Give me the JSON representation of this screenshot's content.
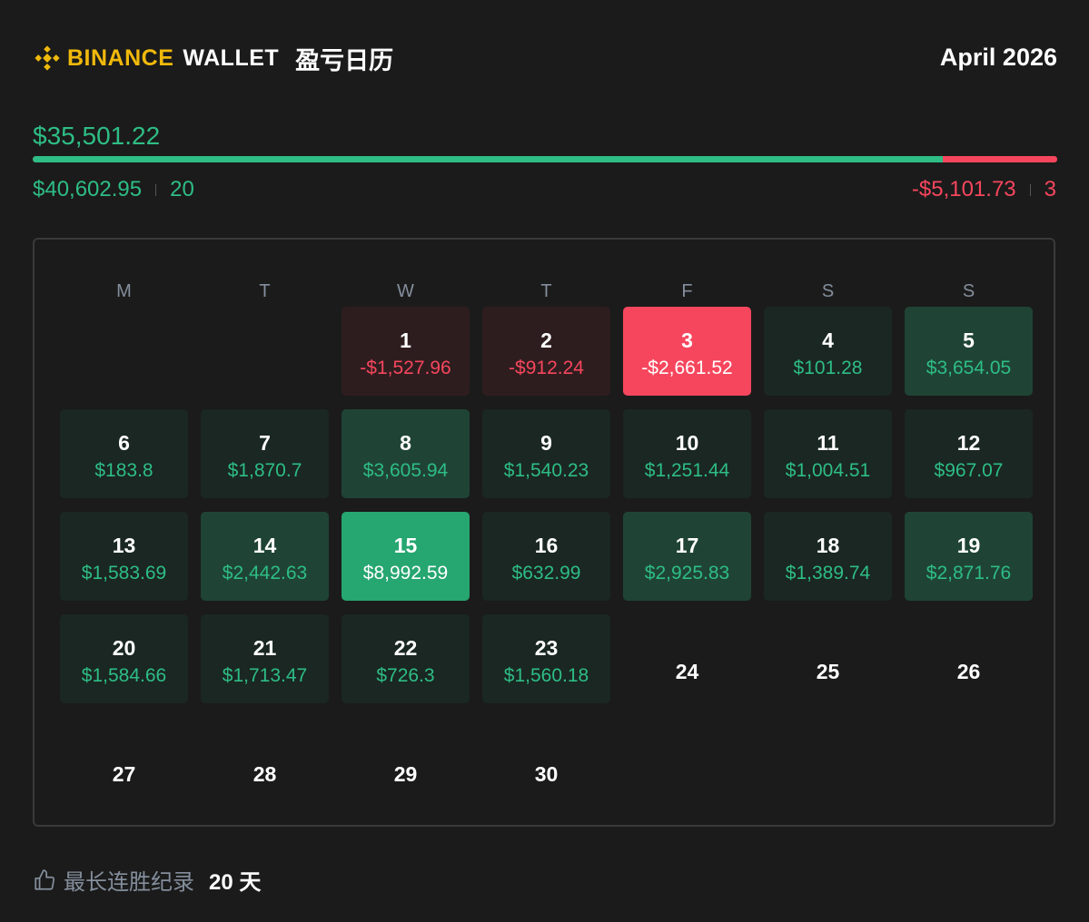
{
  "header": {
    "brand_primary": "BINANCE",
    "brand_secondary": "WALLET",
    "title": "盈亏日历",
    "month_label": "April 2026"
  },
  "summary": {
    "net_total": "$35,501.22",
    "profit_total": "$40,602.95",
    "profit_days": "20",
    "loss_total": "-$5,101.73",
    "loss_days": "3",
    "profit_share": 0.888
  },
  "weekdays": [
    "M",
    "T",
    "W",
    "T",
    "F",
    "S",
    "S"
  ],
  "days": [
    {
      "day": "1",
      "value": "-$1,527.96",
      "tone": "loss-light"
    },
    {
      "day": "2",
      "value": "-$912.24",
      "tone": "loss-light"
    },
    {
      "day": "3",
      "value": "-$2,661.52",
      "tone": "loss-strong"
    },
    {
      "day": "4",
      "value": "$101.28",
      "tone": "gain-1"
    },
    {
      "day": "5",
      "value": "$3,654.05",
      "tone": "gain-2"
    },
    {
      "day": "6",
      "value": "$183.8",
      "tone": "gain-1"
    },
    {
      "day": "7",
      "value": "$1,870.7",
      "tone": "gain-1"
    },
    {
      "day": "8",
      "value": "$3,605.94",
      "tone": "gain-2"
    },
    {
      "day": "9",
      "value": "$1,540.23",
      "tone": "gain-1"
    },
    {
      "day": "10",
      "value": "$1,251.44",
      "tone": "gain-1"
    },
    {
      "day": "11",
      "value": "$1,004.51",
      "tone": "gain-1"
    },
    {
      "day": "12",
      "value": "$967.07",
      "tone": "gain-1"
    },
    {
      "day": "13",
      "value": "$1,583.69",
      "tone": "gain-1"
    },
    {
      "day": "14",
      "value": "$2,442.63",
      "tone": "gain-2"
    },
    {
      "day": "15",
      "value": "$8,992.59",
      "tone": "gain-max"
    },
    {
      "day": "16",
      "value": "$632.99",
      "tone": "gain-1"
    },
    {
      "day": "17",
      "value": "$2,925.83",
      "tone": "gain-2"
    },
    {
      "day": "18",
      "value": "$1,389.74",
      "tone": "gain-1"
    },
    {
      "day": "19",
      "value": "$2,871.76",
      "tone": "gain-2"
    },
    {
      "day": "20",
      "value": "$1,584.66",
      "tone": "gain-1"
    },
    {
      "day": "21",
      "value": "$1,713.47",
      "tone": "gain-1"
    },
    {
      "day": "22",
      "value": "$726.3",
      "tone": "gain-1"
    },
    {
      "day": "23",
      "value": "$1,560.18",
      "tone": "gain-1"
    },
    {
      "day": "24",
      "value": "",
      "tone": "empty"
    },
    {
      "day": "25",
      "value": "",
      "tone": "empty"
    },
    {
      "day": "26",
      "value": "",
      "tone": "empty"
    },
    {
      "day": "27",
      "value": "",
      "tone": "empty"
    },
    {
      "day": "28",
      "value": "",
      "tone": "empty"
    },
    {
      "day": "29",
      "value": "",
      "tone": "empty"
    },
    {
      "day": "30",
      "value": "",
      "tone": "empty"
    }
  ],
  "first_weekday_index": 2,
  "footer": {
    "icon": "thumbs-up-icon",
    "streak_label": "最长连胜纪录",
    "streak_value": "20 天"
  },
  "colors": {
    "profit": "#2ebd85",
    "loss": "#f6465d",
    "brand": "#f0b90b",
    "background": "#1b1b1b"
  }
}
